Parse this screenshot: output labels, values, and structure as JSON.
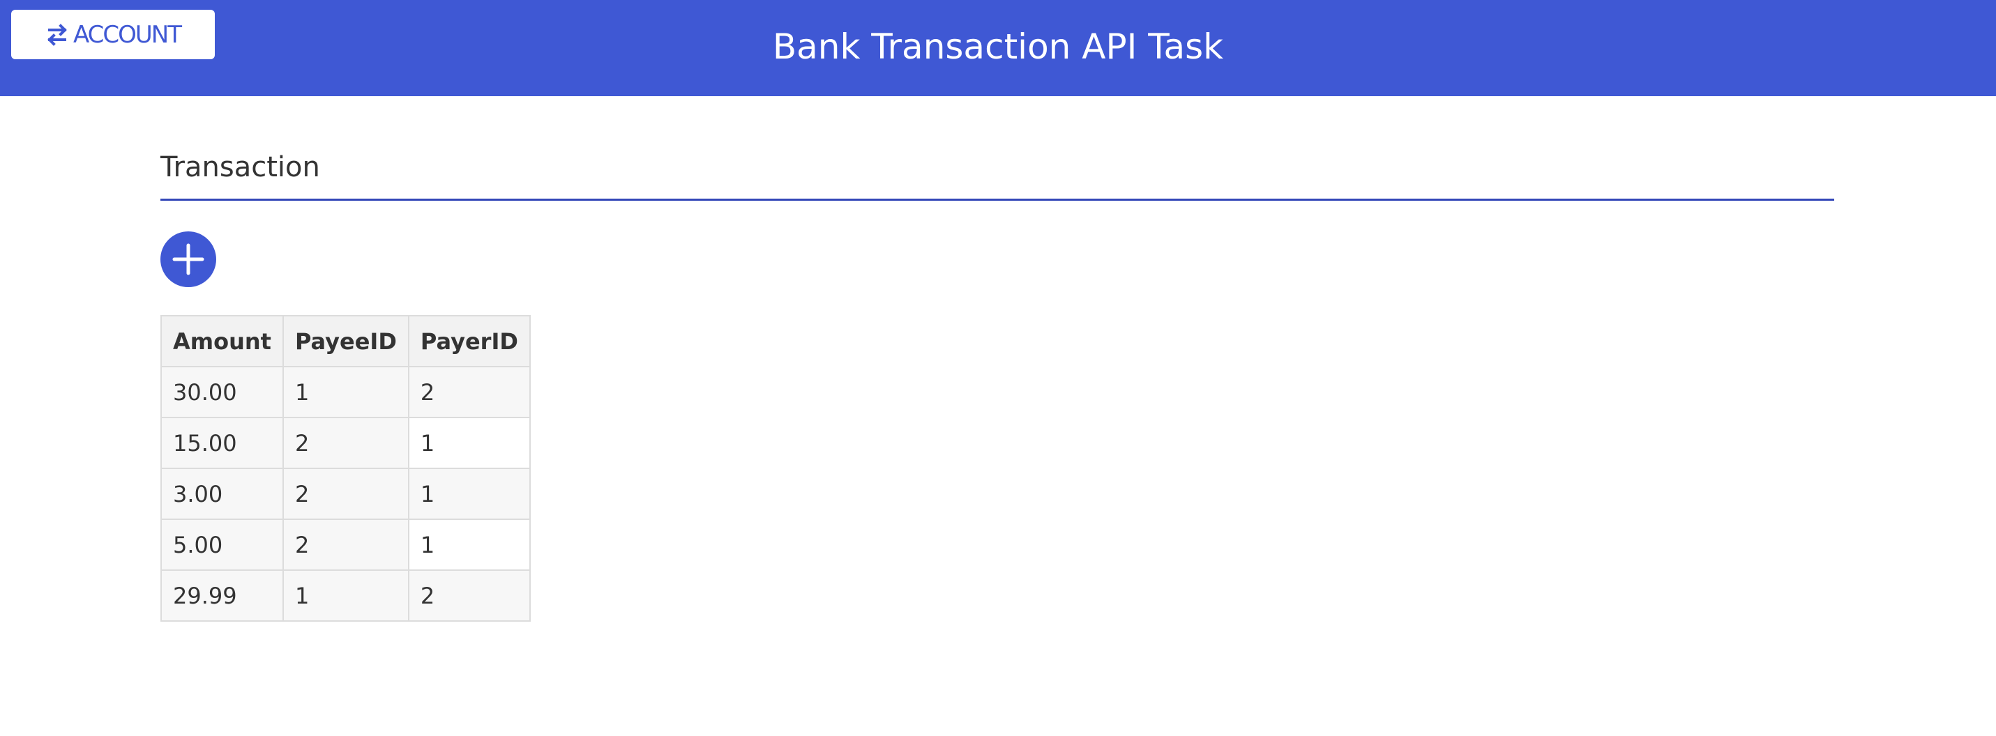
{
  "header": {
    "title": "Bank Transaction API Task",
    "account_button_label": "ACCOUNT",
    "account_button_icon": "swap-arrows-icon",
    "background_color": "#3f58d4"
  },
  "main": {
    "section_title": "Transaction",
    "add_button_icon": "plus-icon",
    "table": {
      "columns": [
        "Amount",
        "PayeeID",
        "PayerID"
      ],
      "rows": [
        [
          "30.00",
          "1",
          "2"
        ],
        [
          "15.00",
          "2",
          "1"
        ],
        [
          "3.00",
          "2",
          "1"
        ],
        [
          "5.00",
          "2",
          "1"
        ],
        [
          "29.99",
          "1",
          "2"
        ]
      ]
    }
  }
}
